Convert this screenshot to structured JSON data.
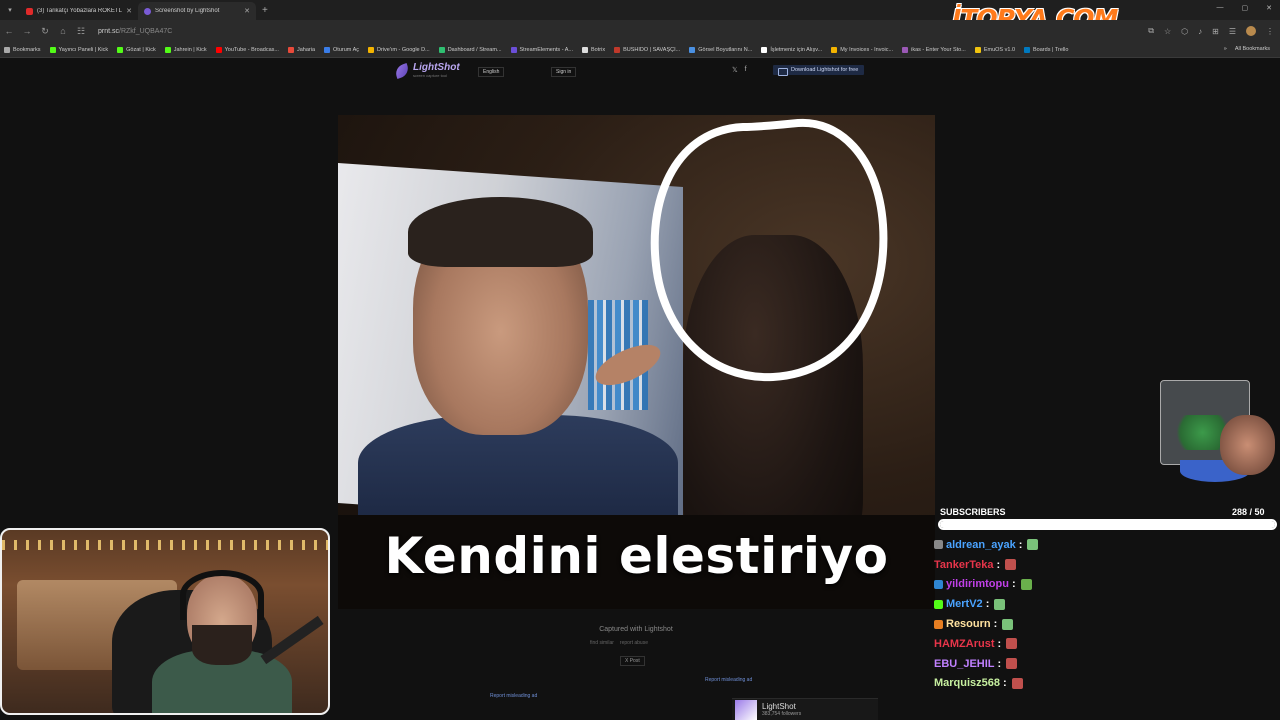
{
  "browser": {
    "tabs": [
      {
        "title": "(3) Tarikatçı Yobazlara ROKETLİ",
        "active": false
      },
      {
        "title": "Screenshot by Lightshot",
        "active": true
      }
    ],
    "url_host": "prnt.sc",
    "url_path": "/RZkf_UQBA47C",
    "window_controls": [
      "—",
      "▢",
      "✕"
    ],
    "bookmarks": [
      {
        "label": "Bookmarks",
        "color": "#aaaaaa"
      },
      {
        "label": "Yayıncı Paneli | Kick",
        "color": "#53fc18"
      },
      {
        "label": "Gözat | Kick",
        "color": "#53fc18"
      },
      {
        "label": "Jahrein | Kick",
        "color": "#53fc18"
      },
      {
        "label": "YouTube - Broadcas...",
        "color": "#ff0000"
      },
      {
        "label": "Jaharia",
        "color": "#e84a3a"
      },
      {
        "label": "Oturum Aç",
        "color": "#3a7de8"
      },
      {
        "label": "Drive'ım - Google D...",
        "color": "#f4b400"
      },
      {
        "label": "Dashboard / Stream...",
        "color": "#2fbf71"
      },
      {
        "label": "StreamElements - A...",
        "color": "#6b4fd8"
      },
      {
        "label": "Botrix",
        "color": "#dddddd"
      },
      {
        "label": "BUSHIDO | SAVAŞÇI...",
        "color": "#c0392b"
      },
      {
        "label": "Görsel Boyutlarını N...",
        "color": "#4a90e2"
      },
      {
        "label": "İşletmeniz için Alışv...",
        "color": "#ffffff"
      },
      {
        "label": "My Invoices - Invoic...",
        "color": "#f4b400"
      },
      {
        "label": "ikas - Enter Your Sto...",
        "color": "#9b59b6"
      },
      {
        "label": "EmuOS v1.0",
        "color": "#f1c40f"
      },
      {
        "label": "Boards | Trello",
        "color": "#0079bf"
      }
    ],
    "all_bookmarks": "All Bookmarks",
    "overlay_logo": "İTOPYA.COM"
  },
  "lightshot": {
    "brand": "LightShot",
    "tagline": "screen capture tool",
    "language": "English",
    "sign_in": "Sign in",
    "download": "Download Lightshot for free",
    "caption": "Kendini elestiriyo",
    "captured_with": "Captured with Lightshot",
    "find_similar": "find similar",
    "report_abuse": "report abuse",
    "post": "X Post",
    "report_ad_1": "Report misleading ad",
    "report_ad_2": "Report misleading ad",
    "fb_name": "LightShot",
    "fb_followers": "383,754 followers"
  },
  "stream": {
    "subscribers_label": "SUBSCRIBERS",
    "subscribers_count": "288 / 50",
    "subscribers_progress": 1.0,
    "chat": [
      {
        "user": "aldrean_ayak",
        "color": "#4aa3ff",
        "badge": "#888888",
        "emote": "#7ac27a"
      },
      {
        "user": "TankerTeka",
        "color": "#e8354a",
        "badge": "",
        "emote": "#c0504d"
      },
      {
        "user": "yildirimtopu",
        "color": "#c040e8",
        "badge": "#2f86d1",
        "emote": "#6ab04c"
      },
      {
        "user": "MertV2",
        "color": "#4aa3ff",
        "badge": "#53fc18",
        "emote": "#7ac27a"
      },
      {
        "user": "Resourn",
        "color": "#ffe2a0",
        "badge": "#e67e22",
        "emote": "#7ac27a"
      },
      {
        "user": "HAMZArust",
        "color": "#e8354a",
        "badge": "",
        "emote": "#c0504d"
      },
      {
        "user": "EBU_JEHIL",
        "color": "#c080ff",
        "badge": "",
        "emote": "#c0504d"
      },
      {
        "user": "Marquisz568",
        "color": "#c7f0a0",
        "badge": "",
        "emote": "#c0504d"
      }
    ]
  }
}
